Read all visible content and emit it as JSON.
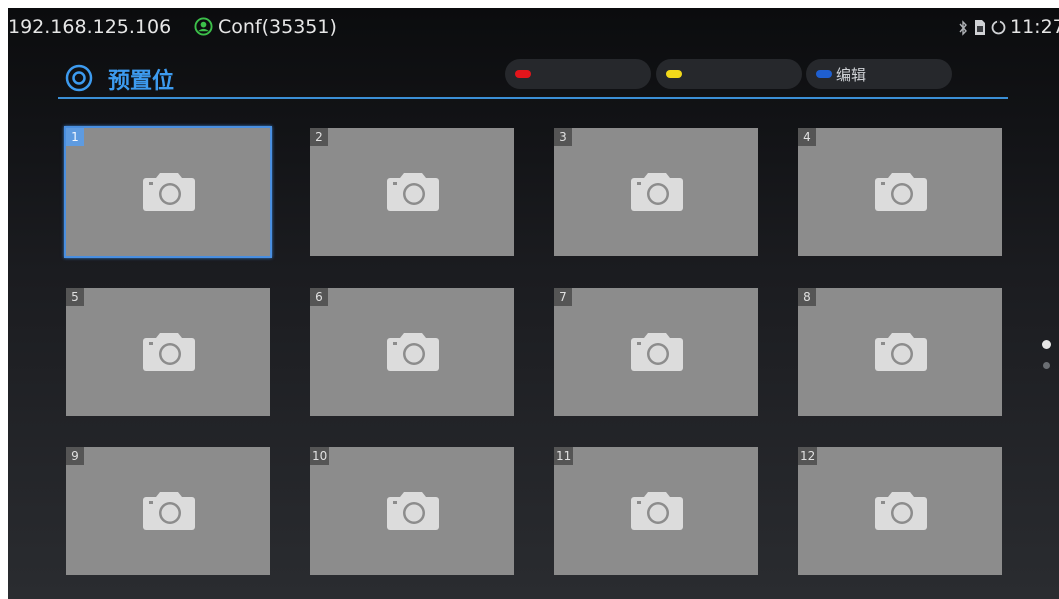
{
  "status_bar": {
    "ip": "192.168.125.106",
    "conf": "Conf(35351)",
    "time": "11:27",
    "icons": [
      "account-icon",
      "bluetooth-icon",
      "sim-icon",
      "sync-icon"
    ]
  },
  "header": {
    "title": "预置位",
    "logo_icon": "preset-logo-icon",
    "keys": [
      {
        "color_name": "red",
        "color": "#e3151b",
        "label": ""
      },
      {
        "color_name": "yellow",
        "color": "#f2d81a",
        "label": ""
      },
      {
        "color_name": "blue",
        "color": "#1f5fd0",
        "label": "编辑"
      }
    ]
  },
  "presets": [
    {
      "number": "1",
      "selected": true,
      "icon": "camera-icon"
    },
    {
      "number": "2",
      "selected": false,
      "icon": "camera-icon"
    },
    {
      "number": "3",
      "selected": false,
      "icon": "camera-icon"
    },
    {
      "number": "4",
      "selected": false,
      "icon": "camera-icon"
    },
    {
      "number": "5",
      "selected": false,
      "icon": "camera-icon"
    },
    {
      "number": "6",
      "selected": false,
      "icon": "camera-icon"
    },
    {
      "number": "7",
      "selected": false,
      "icon": "camera-icon"
    },
    {
      "number": "8",
      "selected": false,
      "icon": "camera-icon"
    },
    {
      "number": "9",
      "selected": false,
      "icon": "camera-icon"
    },
    {
      "number": "10",
      "selected": false,
      "icon": "camera-icon"
    },
    {
      "number": "11",
      "selected": false,
      "icon": "camera-icon"
    },
    {
      "number": "12",
      "selected": false,
      "icon": "camera-icon"
    }
  ],
  "pagination": {
    "pages": 2,
    "current": 1
  },
  "colors": {
    "accent": "#3d9bef",
    "tile_bg": "#8c8c8c"
  }
}
